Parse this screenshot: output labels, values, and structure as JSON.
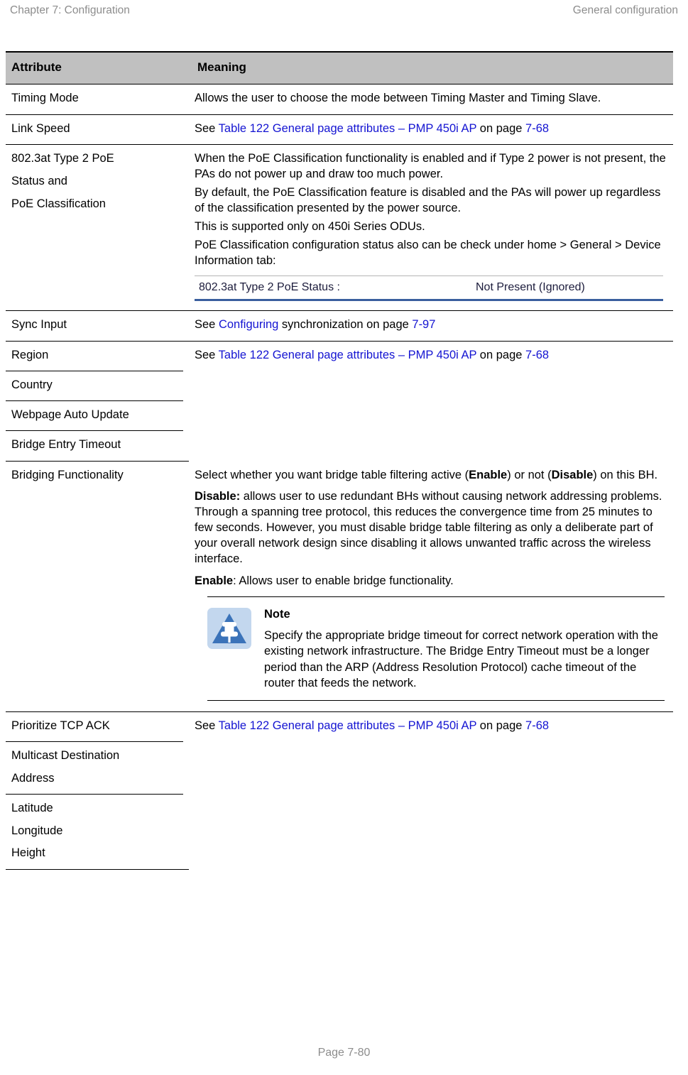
{
  "running_header": {
    "left": "Chapter 7:  Configuration",
    "right": "General configuration"
  },
  "table": {
    "columns": {
      "attribute": "Attribute",
      "meaning": "Meaning"
    },
    "rows": [
      {
        "attribute": "Timing Mode",
        "meaning": "Allows the user to choose the mode between Timing Master and Timing Slave."
      },
      {
        "attribute": "Link Speed",
        "meaning_prefix": "See ",
        "meaning_link": "Table 122 General page attributes – PMP 450i AP",
        "meaning_middle": " on page ",
        "meaning_page": "7-68"
      },
      {
        "attribute_line1": "802.3at Type 2 PoE",
        "attribute_line2": "Status and",
        "attribute_line3": "PoE Classification",
        "para1": "When the PoE Classification functionality is enabled and if Type 2 power is not present, the PAs do not power up and draw too much power.",
        "para2": "By default, the PoE Classification feature is disabled and the PAs will power up regardless of the classification presented by the power source.",
        "para3": "This is supported only on 450i Series ODUs.",
        "para4": "PoE Classification configuration status also can be check under home > General > Device Information tab:",
        "embedded_screenshot": {
          "label": "802.3at Type 2 PoE Status :",
          "value": "Not Present (Ignored)"
        }
      },
      {
        "attribute": "Sync Input",
        "meaning_prefix": "See ",
        "meaning_link": "Configuring",
        "meaning_middle": " synchronization on page ",
        "meaning_page": "7-97"
      },
      {
        "group_attributes": [
          "Region",
          "Country",
          "Webpage Auto Update",
          "Bridge Entry Timeout"
        ],
        "meaning_prefix": "See ",
        "meaning_link": "Table 122 General page attributes – PMP 450i AP",
        "meaning_middle": " on page ",
        "meaning_page": "7-68"
      },
      {
        "attribute": "Bridging Functionality",
        "para1_a": "Select whether you want bridge table filtering active (",
        "para1_b": "Enable",
        "para1_c": ") or not (",
        "para1_d": "Disable",
        "para1_e": ") on this BH.",
        "para2_bold": "Disable:",
        "para2_rest": " allows user to use redundant BHs without causing network addressing problems. Through a spanning tree protocol, this reduces the convergence time from 25 minutes to few seconds. However, you must disable bridge table filtering as only a deliberate part of your overall network design since disabling it allows unwanted traffic across the wireless interface.",
        "para3_bold": "Enable",
        "para3_rest": ": Allows user to enable bridge functionality.",
        "note": {
          "icon": "note-pushpin-icon",
          "title": "Note",
          "text": "Specify the appropriate bridge timeout for correct network operation with the existing network infrastructure. The Bridge Entry Timeout must be a longer period than the ARP (Address Resolution Protocol) cache timeout of the router that feeds the network."
        }
      },
      {
        "group_attributes_a": [
          "Prioritize TCP ACK"
        ],
        "group_attributes_b": [
          "Multicast Destination",
          "Address"
        ],
        "group_attributes_c": [
          "Latitude",
          "Longitude",
          "Height"
        ],
        "meaning_prefix": "See ",
        "meaning_link": "Table 122 General page attributes – PMP 450i AP",
        "meaning_middle": " on page ",
        "meaning_page": "7-68"
      }
    ]
  },
  "footer": {
    "page_label": "Page 7-80"
  },
  "colors": {
    "link": "#1414d2",
    "header_band": "#c0c0c0",
    "note_icon_bg": "#c3d7ee",
    "note_icon_triangle": "#3b73b9",
    "muted_text": "#8d8d8d"
  }
}
